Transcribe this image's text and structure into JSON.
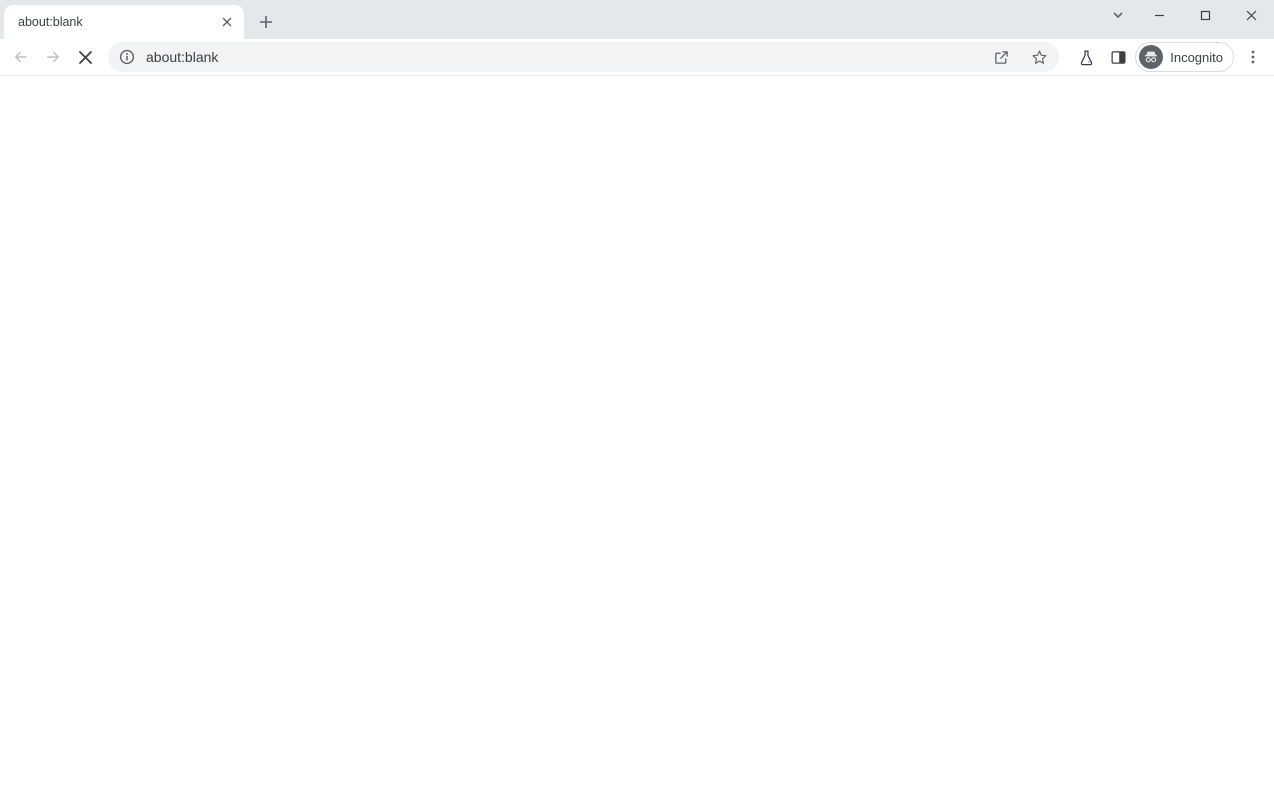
{
  "tab": {
    "title": "about:blank"
  },
  "omnibox": {
    "url": "about:blank"
  },
  "profile": {
    "label": "Incognito"
  }
}
